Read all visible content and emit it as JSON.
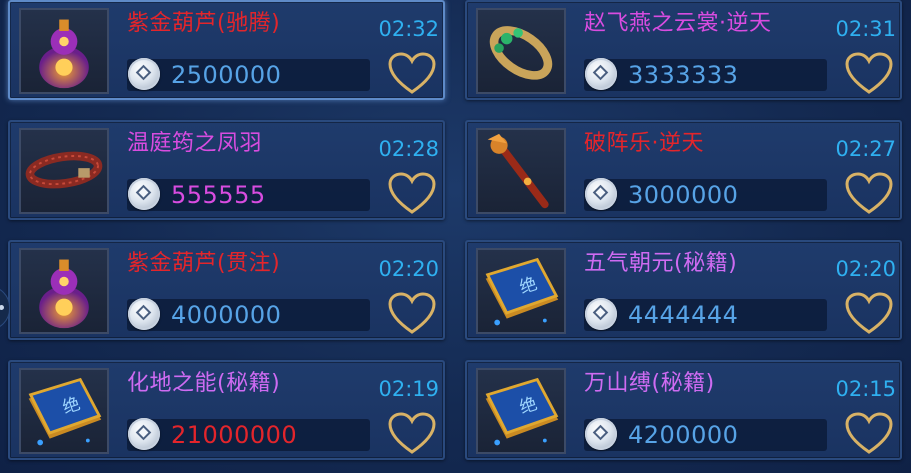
{
  "colors": {
    "name_red": "#e3252b",
    "name_magenta": "#d84ce0",
    "name_violet": "#ce6bf2",
    "price_blue": "#57a3e6",
    "price_magenta": "#d84ce0",
    "price_red": "#e3252b",
    "timer_blue": "#2fb0f0",
    "heart_gold": "#d8b266"
  },
  "listings": [
    {
      "name": "紫金葫芦(驰腾)",
      "price": "2500000",
      "time": "02:32",
      "name_color": "#e3252b",
      "price_color": "#57a3e6",
      "icon": "purple-gourd-icon",
      "selected": true
    },
    {
      "name": "赵飞燕之云裳·逆天",
      "price": "3333333",
      "time": "02:31",
      "name_color": "#d84ce0",
      "price_color": "#57a3e6",
      "icon": "jade-bangle-icon",
      "selected": false
    },
    {
      "name": "温庭筠之凤羽",
      "price": "555555",
      "time": "02:28",
      "name_color": "#d84ce0",
      "price_color": "#d84ce0",
      "icon": "leather-belt-icon",
      "selected": false
    },
    {
      "name": "破阵乐·逆天",
      "price": "3000000",
      "time": "02:27",
      "name_color": "#e3252b",
      "price_color": "#57a3e6",
      "icon": "dragon-staff-icon",
      "selected": false
    },
    {
      "name": "紫金葫芦(贯注)",
      "price": "4000000",
      "time": "02:20",
      "name_color": "#e3252b",
      "price_color": "#57a3e6",
      "icon": "purple-gourd-icon",
      "selected": false
    },
    {
      "name": "五气朝元(秘籍)",
      "price": "4444444",
      "time": "02:20",
      "name_color": "#ce6bf2",
      "price_color": "#57a3e6",
      "icon": "secret-book-icon",
      "selected": false
    },
    {
      "name": "化地之能(秘籍)",
      "price": "21000000",
      "time": "02:19",
      "name_color": "#ce6bf2",
      "price_color": "#e3252b",
      "icon": "secret-book-icon",
      "selected": false
    },
    {
      "name": "万山缚(秘籍)",
      "price": "4200000",
      "time": "02:15",
      "name_color": "#ce6bf2",
      "price_color": "#57a3e6",
      "icon": "secret-book-icon",
      "selected": false
    }
  ]
}
